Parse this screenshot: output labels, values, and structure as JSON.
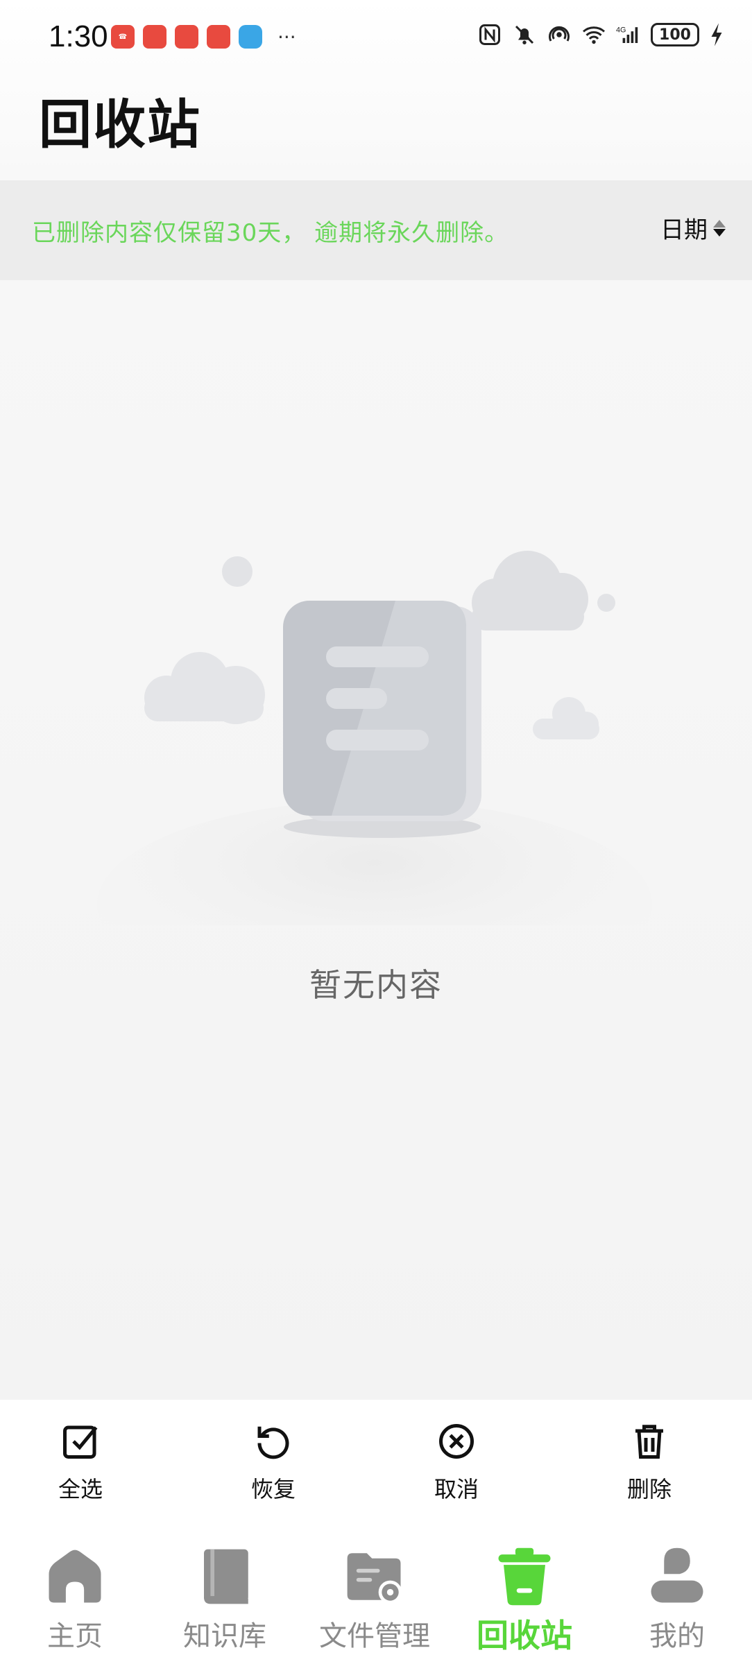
{
  "status_bar": {
    "time": "1:30",
    "notification_icons": [
      "phone-app-icon",
      "huawei-store-icon",
      "game-app-icon",
      "huawei-app-icon",
      "browser-app-icon"
    ],
    "more_indicator": "···",
    "network": "4G",
    "battery": "100"
  },
  "header": {
    "title": "回收站"
  },
  "notice": {
    "text": "已删除内容仅保留30天， 逾期将永久删除。",
    "sort_label": "日期"
  },
  "empty_state": {
    "text": "暂无内容"
  },
  "actions": [
    {
      "label": "全选",
      "icon": "select-all-checkbox-icon"
    },
    {
      "label": "恢复",
      "icon": "restore-icon"
    },
    {
      "label": "取消",
      "icon": "cancel-circle-icon"
    },
    {
      "label": "删除",
      "icon": "trash-icon"
    }
  ],
  "tabs": [
    {
      "label": "主页",
      "icon": "home-icon",
      "active": false
    },
    {
      "label": "知识库",
      "icon": "book-icon",
      "active": false
    },
    {
      "label": "文件管理",
      "icon": "folder-settings-icon",
      "active": false
    },
    {
      "label": "回收站",
      "icon": "trash-icon",
      "active": true
    },
    {
      "label": "我的",
      "icon": "user-icon",
      "active": false
    }
  ],
  "colors": {
    "accent": "#58d63a",
    "notice_text": "#6ad65a",
    "inactive_tab": "#8a8a8a"
  }
}
